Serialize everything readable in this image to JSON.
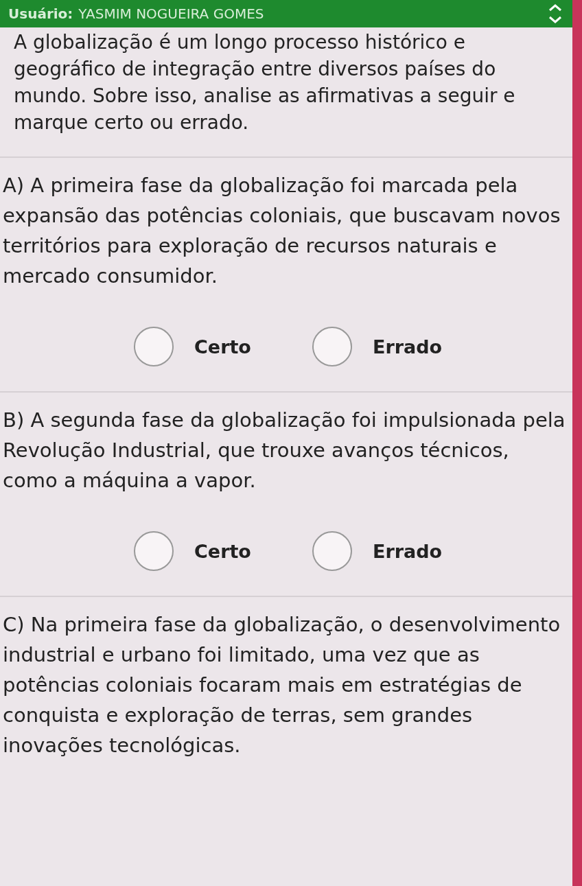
{
  "header": {
    "label": "Usuário:",
    "user": "YASMIM NOGUEIRA GOMES"
  },
  "intro": "A globalização é um longo processo histórico e geográfico de integração entre diversos países do mundo. Sobre isso, analise as afirmativas a seguir e marque certo ou errado.",
  "questions": [
    {
      "text": "A) A primeira fase da globalização foi marcada pela expansão das potências coloniais, que buscavam novos territórios para exploração de recursos naturais e mercado consumidor.",
      "options": [
        {
          "label": "Certo",
          "selected": false
        },
        {
          "label": "Errado",
          "selected": false
        }
      ]
    },
    {
      "text": "B) A segunda fase da globalização foi impulsionada pela Revolução Industrial, que trouxe avanços técnicos, como a máquina a vapor.",
      "options": [
        {
          "label": "Certo",
          "selected": false
        },
        {
          "label": "Errado",
          "selected": false
        }
      ]
    },
    {
      "text": "C) Na primeira fase da globalização, o desenvolvimento industrial e urbano foi limitado, uma vez que as potências coloniais focaram mais em estratégias de conquista e exploração de terras, sem grandes inovações tecnológicas."
    }
  ]
}
